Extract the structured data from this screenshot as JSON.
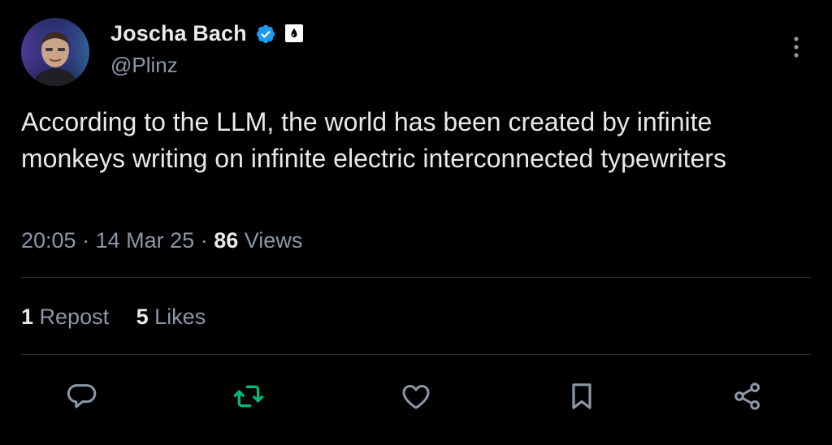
{
  "author": {
    "display_name": "Joscha Bach",
    "handle": "@Plinz",
    "verified_icon": "verified-badge-icon",
    "affiliate_icon": "affiliate-badge-icon"
  },
  "tweet": {
    "text": "According to the LLM, the world has been created by infinite monkeys writing on infinite electric interconnected typewriters",
    "time": "20:05",
    "date": "14 Mar 25",
    "separator": "·",
    "views_count": "86",
    "views_label": "Views"
  },
  "stats": {
    "reposts_count": "1",
    "reposts_label": "Repost",
    "likes_count": "5",
    "likes_label": "Likes"
  },
  "actions": [
    {
      "name": "reply",
      "icon": "reply-icon"
    },
    {
      "name": "repost",
      "icon": "repost-icon"
    },
    {
      "name": "like",
      "icon": "heart-icon"
    },
    {
      "name": "bookmark",
      "icon": "bookmark-icon"
    },
    {
      "name": "share",
      "icon": "share-icon"
    }
  ],
  "colors": {
    "background": "#000000",
    "text_primary": "#e7e9ea",
    "text_secondary": "#8b98a5",
    "verified_blue": "#1d9bf0",
    "repost_green": "#00ba7c",
    "divider": "#2f3336"
  }
}
